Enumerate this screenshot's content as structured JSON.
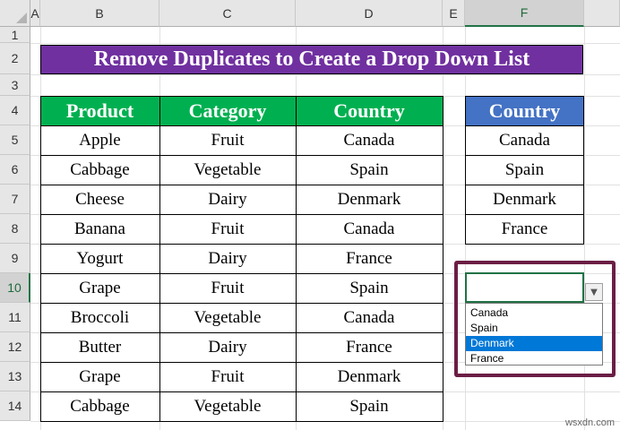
{
  "columns": [
    "A",
    "B",
    "C",
    "D",
    "E",
    "F"
  ],
  "rows": [
    "1",
    "2",
    "3",
    "4",
    "5",
    "6",
    "7",
    "8",
    "9",
    "10",
    "11",
    "12",
    "13",
    "14"
  ],
  "title": "Remove Duplicates to Create a Drop Down List",
  "table": {
    "headers": [
      "Product",
      "Category",
      "Country"
    ],
    "rows": [
      [
        "Apple",
        "Fruit",
        "Canada"
      ],
      [
        "Cabbage",
        "Vegetable",
        "Spain"
      ],
      [
        "Cheese",
        "Dairy",
        "Denmark"
      ],
      [
        "Banana",
        "Fruit",
        "Canada"
      ],
      [
        "Yogurt",
        "Dairy",
        "France"
      ],
      [
        "Grape",
        "Fruit",
        "Spain"
      ],
      [
        "Broccoli",
        "Vegetable",
        "Canada"
      ],
      [
        "Butter",
        "Dairy",
        "France"
      ],
      [
        "Grape",
        "Fruit",
        "Denmark"
      ],
      [
        "Cabbage",
        "Vegetable",
        "Spain"
      ]
    ]
  },
  "unique": {
    "header": "Country",
    "values": [
      "Canada",
      "Spain",
      "Denmark",
      "France"
    ]
  },
  "dropdown": {
    "options": [
      "Canada",
      "Spain",
      "Denmark",
      "France"
    ],
    "highlighted": "Denmark",
    "arrow_icon": "chevron-down-icon"
  },
  "watermark": "wsxdn.com",
  "colors": {
    "title_bg": "#7030a0",
    "table_header_bg": "#00b050",
    "unique_header_bg": "#4472c4",
    "frame": "#6b1e45",
    "selection": "#217346",
    "highlight": "#0078d7"
  }
}
